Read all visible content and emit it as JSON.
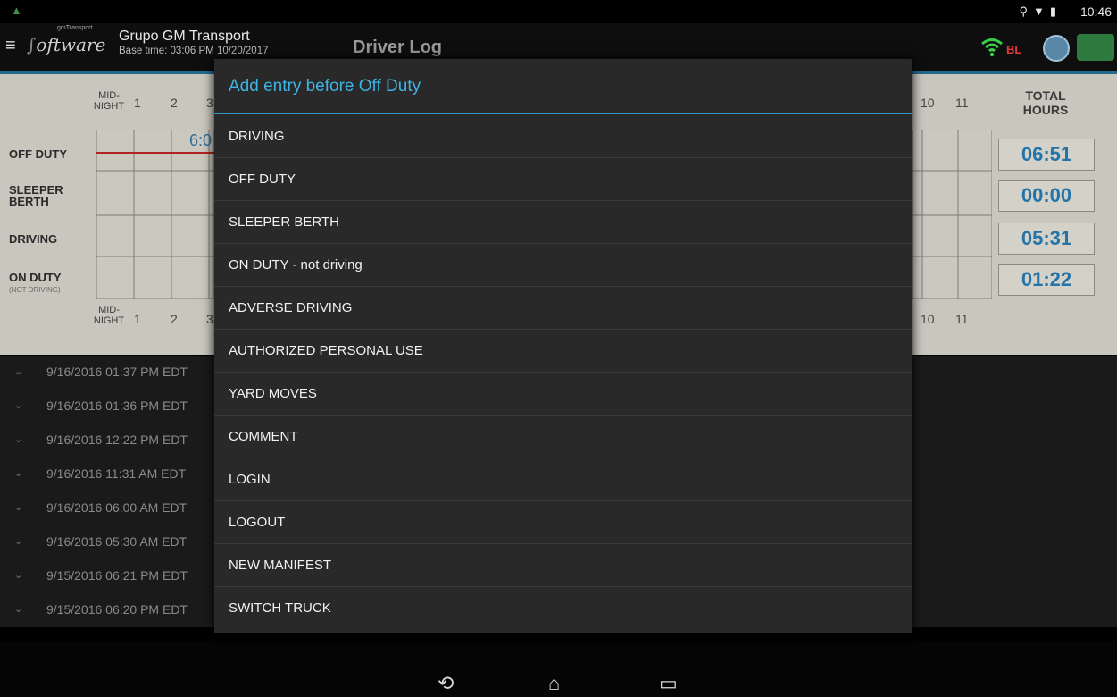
{
  "status_bar": {
    "time": "10:46",
    "icons": [
      "location-icon",
      "wifi-icon",
      "battery-icon"
    ]
  },
  "header": {
    "logo_text": "oftware",
    "logo_small": "gmTransport",
    "company": "Grupo GM Transport",
    "base_time": "Base time: 03:06 PM 10/20/2017",
    "title": "Driver Log",
    "bl_label": "BL"
  },
  "grid": {
    "midnight_top": "MID-\nNIGHT",
    "midnight_bottom": "MID-\nNIGHT",
    "hours_left": [
      "1",
      "2",
      "3"
    ],
    "hours_right": [
      "10",
      "11"
    ],
    "partial_text": "6:0",
    "total_header": "TOTAL\nHOURS",
    "rows": [
      {
        "label": "OFF DUTY",
        "sub": "",
        "total": "06:51"
      },
      {
        "label": "SLEEPER\nBERTH",
        "sub": "",
        "total": "00:00"
      },
      {
        "label": "DRIVING",
        "sub": "",
        "total": "05:31"
      },
      {
        "label": "ON DUTY",
        "sub": "(NOT DRIVING)",
        "total": "01:22"
      }
    ]
  },
  "log_entries": [
    "9/16/2016 01:37 PM EDT",
    "9/16/2016 01:36 PM EDT",
    "9/16/2016 12:22 PM EDT",
    "9/16/2016 11:31 AM EDT",
    "9/16/2016 06:00 AM EDT",
    "9/16/2016 05:30 AM EDT",
    "9/15/2016 06:21 PM EDT",
    "9/15/2016 06:20 PM EDT"
  ],
  "dialog": {
    "title": "Add entry before Off Duty",
    "items": [
      "DRIVING",
      "OFF DUTY",
      "SLEEPER BERTH",
      "ON DUTY - not driving",
      "ADVERSE DRIVING",
      "AUTHORIZED PERSONAL USE",
      "YARD MOVES",
      "COMMENT",
      "LOGIN",
      "LOGOUT",
      "NEW MANIFEST",
      "SWITCH TRUCK"
    ]
  },
  "colors": {
    "accent": "#3fb3e4",
    "total_text": "#2374a9",
    "off_duty_line": "#b32222",
    "bl_red": "#e23b3b"
  }
}
